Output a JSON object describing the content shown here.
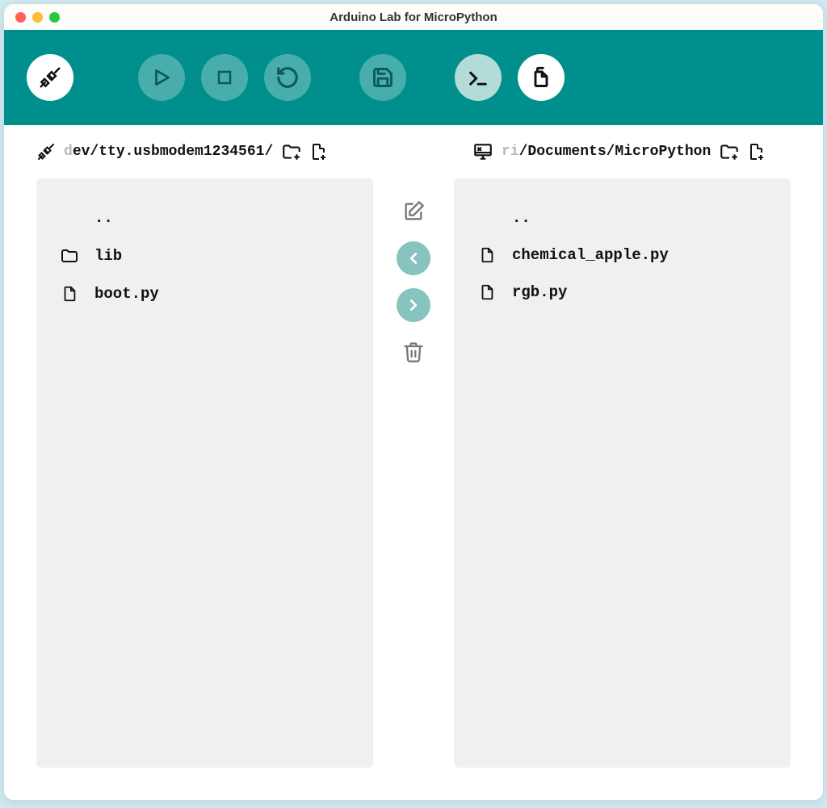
{
  "window": {
    "title": "Arduino Lab for MicroPython"
  },
  "toolbar": {
    "connect": "connect",
    "run": "run",
    "stop": "stop",
    "reset": "reset",
    "save": "save",
    "terminal": "terminal",
    "files": "files"
  },
  "device": {
    "path_dim": "d",
    "path": "ev/tty.usbmodem1234561/",
    "items": [
      {
        "type": "up",
        "name": ".."
      },
      {
        "type": "folder",
        "name": "lib"
      },
      {
        "type": "file",
        "name": "boot.py"
      }
    ]
  },
  "local": {
    "path_dim": "ri",
    "path": "/Documents/MicroPython",
    "items": [
      {
        "type": "up",
        "name": ".."
      },
      {
        "type": "file",
        "name": "chemical_apple.py"
      },
      {
        "type": "file",
        "name": "rgb.py"
      }
    ]
  },
  "colors": {
    "teal": "#008f8c",
    "panel": "#f0f0f0",
    "midcircle": "#87c3bf"
  }
}
